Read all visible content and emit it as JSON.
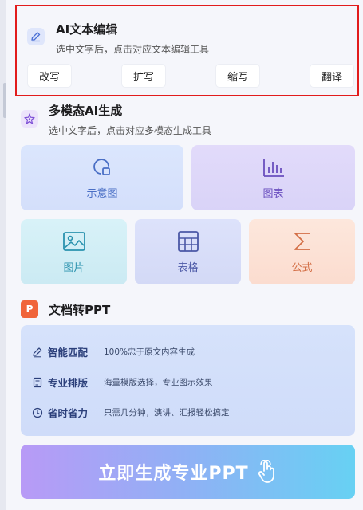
{
  "ai_edit": {
    "title": "AI文本编辑",
    "subtitle": "选中文字后，点击对应文本编辑工具",
    "icon": "pencil-icon",
    "buttons": [
      {
        "label": "改写"
      },
      {
        "label": "扩写"
      },
      {
        "label": "缩写"
      },
      {
        "label": "翻译"
      }
    ]
  },
  "multimodal": {
    "title": "多模态AI生成",
    "subtitle": "选中文字后，点击对应多模态生成工具",
    "icon": "sparkle-icon",
    "cards": {
      "diagram": {
        "label": "示意图",
        "icon": "diagram-icon"
      },
      "chart": {
        "label": "图表",
        "icon": "bar-chart-icon"
      },
      "image": {
        "label": "图片",
        "icon": "image-icon"
      },
      "table": {
        "label": "表格",
        "icon": "table-icon"
      },
      "formula": {
        "label": "公式",
        "icon": "sigma-icon"
      }
    }
  },
  "doc_ppt": {
    "title": "文档转PPT",
    "icon_text": "P",
    "features": [
      {
        "name": "智能匹配",
        "desc": "100%忠于原文内容生成",
        "icon": "pen-icon"
      },
      {
        "name": "专业排版",
        "desc": "海量模版选择，专业图示效果",
        "icon": "document-icon"
      },
      {
        "name": "省时省力",
        "desc": "只需几分钟，演讲、汇报轻松搞定",
        "icon": "clock-icon"
      }
    ],
    "cta_label": "立即生成专业PPT"
  },
  "colors": {
    "highlight_border": "#e21c1c",
    "ppt_orange": "#f0643a"
  }
}
